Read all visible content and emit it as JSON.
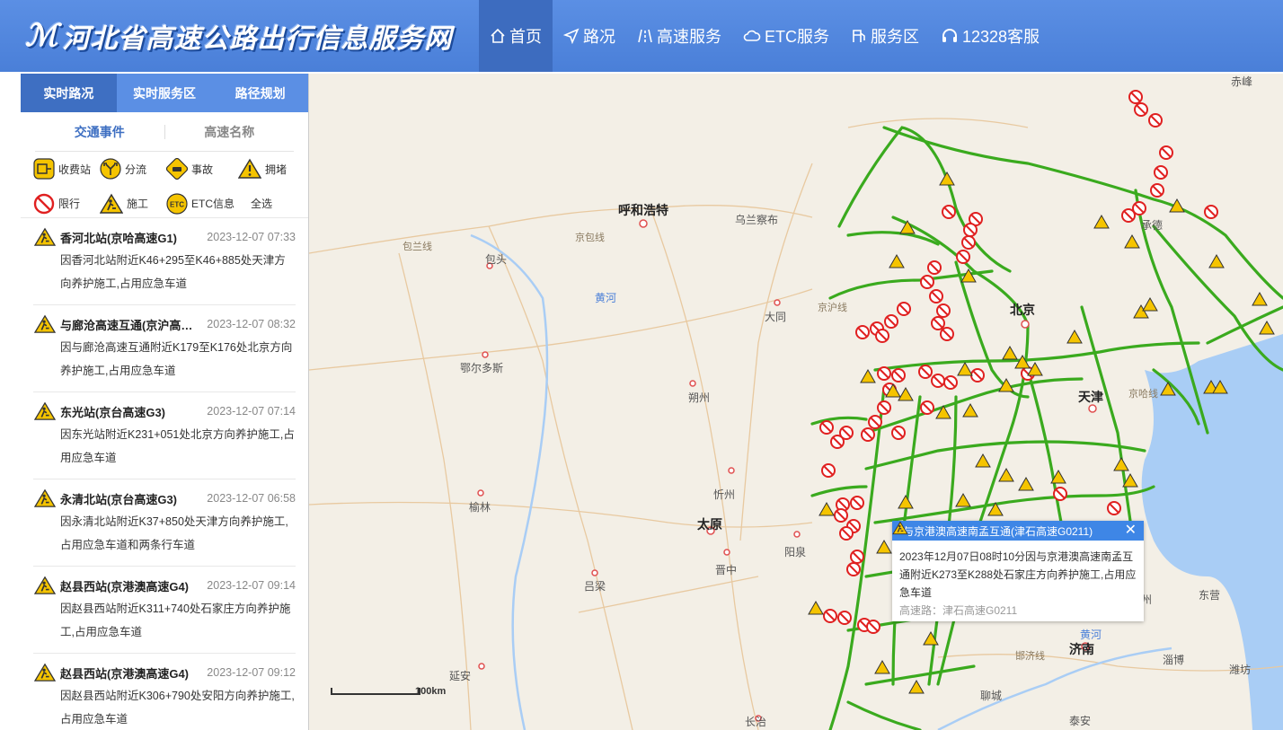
{
  "header": {
    "logo_text": "河北省高速公路出行信息服务网",
    "nav": [
      {
        "label": "首页",
        "icon": "home-icon",
        "active": true
      },
      {
        "label": "路况",
        "icon": "navigation-icon",
        "active": false
      },
      {
        "label": "高速服务",
        "icon": "highway-icon",
        "active": false
      },
      {
        "label": "ETC服务",
        "icon": "cloud-icon",
        "active": false
      },
      {
        "label": "服务区",
        "icon": "fuel-icon",
        "active": false
      },
      {
        "label": "12328客服",
        "icon": "headset-icon",
        "active": false
      }
    ]
  },
  "sidebar": {
    "tabs": [
      {
        "label": "实时路况",
        "active": true
      },
      {
        "label": "实时服务区",
        "active": false
      },
      {
        "label": "路径规划",
        "active": false
      }
    ],
    "subtabs": [
      {
        "label": "交通事件",
        "active": true
      },
      {
        "label": "高速名称",
        "active": false
      }
    ],
    "filters": [
      {
        "label": "收费站",
        "icon": "toll-station-icon"
      },
      {
        "label": "分流",
        "icon": "diversion-icon"
      },
      {
        "label": "事故",
        "icon": "accident-icon"
      },
      {
        "label": "拥堵",
        "icon": "congestion-icon"
      },
      {
        "label": "限行",
        "icon": "restriction-icon"
      },
      {
        "label": "施工",
        "icon": "construction-icon"
      },
      {
        "label": "ETC信息",
        "icon": "etc-icon"
      },
      {
        "label": "全选",
        "icon": ""
      }
    ],
    "events": [
      {
        "title": "香河北站(京哈高速G1)",
        "time": "2023-12-07 07:33",
        "desc": "因香河北站附近K46+295至K46+885处天津方向养护施工,占用应急车道"
      },
      {
        "title": "与廊沧高速互通(京沪高速G2)",
        "time": "2023-12-07 08:32",
        "desc": "因与廊沧高速互通附近K179至K176处北京方向养护施工,占用应急车道"
      },
      {
        "title": "东光站(京台高速G3)",
        "time": "2023-12-07 07:14",
        "desc": "因东光站附近K231+051处北京方向养护施工,占用应急车道"
      },
      {
        "title": "永清北站(京台高速G3)",
        "time": "2023-12-07 06:58",
        "desc": "因永清北站附近K37+850处天津方向养护施工,占用应急车道和两条行车道"
      },
      {
        "title": "赵县西站(京港澳高速G4)",
        "time": "2023-12-07 09:14",
        "desc": "因赵县西站附近K311+740处石家庄方向养护施工,占用应急车道"
      },
      {
        "title": "赵县西站(京港澳高速G4)",
        "time": "2023-12-07 09:12",
        "desc": "因赵县西站附近K306+790处安阳方向养护施工,占用应急车道"
      }
    ]
  },
  "map": {
    "cities": [
      {
        "name": "呼和浩特",
        "big": true
      },
      {
        "name": "乌兰察布",
        "big": false
      },
      {
        "name": "包头",
        "big": false
      },
      {
        "name": "鄂尔多斯",
        "big": false
      },
      {
        "name": "大同",
        "big": false
      },
      {
        "name": "朔州",
        "big": false
      },
      {
        "name": "忻州",
        "big": false
      },
      {
        "name": "太原",
        "big": true
      },
      {
        "name": "晋中",
        "big": false
      },
      {
        "name": "吕梁",
        "big": false
      },
      {
        "name": "榆林",
        "big": false
      },
      {
        "name": "阳泉",
        "big": false
      },
      {
        "name": "延安",
        "big": false
      },
      {
        "name": "长治",
        "big": false
      },
      {
        "name": "北京",
        "big": true
      },
      {
        "name": "天津",
        "big": true
      },
      {
        "name": "济南",
        "big": true
      },
      {
        "name": "聊城",
        "big": false
      },
      {
        "name": "泰安",
        "big": false
      },
      {
        "name": "淄博",
        "big": false
      },
      {
        "name": "潍坊",
        "big": false
      },
      {
        "name": "滨州",
        "big": false
      },
      {
        "name": "东营",
        "big": false
      },
      {
        "name": "赤峰",
        "big": false
      },
      {
        "name": "承德",
        "big": false
      }
    ],
    "rivers": [
      "黄河",
      "黄河"
    ],
    "road_labels": [
      "包兰线",
      "京包线",
      "京哈线",
      "京沪线",
      "邯济线"
    ],
    "popup": {
      "title": "与京港澳高速南孟互通(津石高速G0211)",
      "desc": "2023年12月07日08时10分因与京港澳高速南孟互通附近K273至K288处石家庄方向养护施工,占用应急车道",
      "road": "高速路：津石高速G0211",
      "close": "✕"
    },
    "scale": "100km",
    "colors": {
      "highway": "#3aaa1e",
      "restriction": "#e02020",
      "construction": "#f5c400",
      "water": "#a9cdf5"
    }
  }
}
